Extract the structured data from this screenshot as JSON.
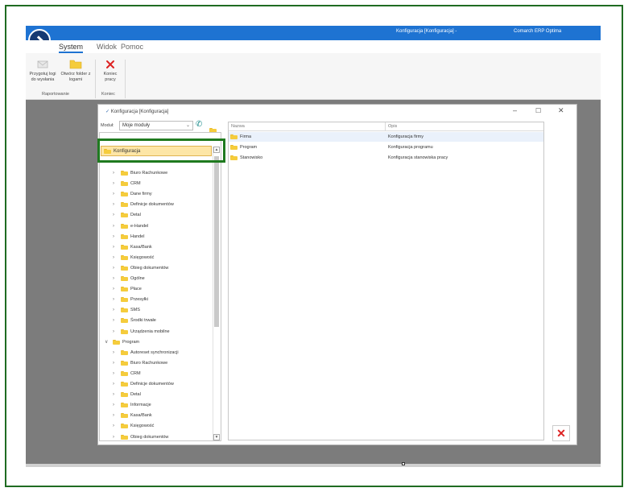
{
  "app": {
    "window_title": "Konfiguracja [Konfiguracja] -",
    "app_name": "Comarch ERP Optima"
  },
  "ribbon": {
    "tabs": [
      {
        "label": "System",
        "active": true
      },
      {
        "label": "Widok",
        "active": false
      },
      {
        "label": "Pomoc",
        "active": false
      }
    ],
    "buttons": {
      "logs_prepare": "Przygotuj logi do wysłania",
      "open_logs_folder": "Otwórz folder z logami",
      "end_work": "Koniec pracy"
    },
    "groups": {
      "reporting": "Raportowanie",
      "end": "Koniec"
    }
  },
  "config_window": {
    "title": "Konfiguracja [Konfiguracja]",
    "module_label": "Moduł:",
    "module_value": "Moje moduły",
    "tree_selected": "Konfiguracja",
    "tree": [
      {
        "label": "Biuro Rachunkowe"
      },
      {
        "label": "CRM"
      },
      {
        "label": "Dane firmy"
      },
      {
        "label": "Definicje dokumentów"
      },
      {
        "label": "Detal"
      },
      {
        "label": "e-Handel"
      },
      {
        "label": "Handel"
      },
      {
        "label": "Kasa/Bank"
      },
      {
        "label": "Księgowość"
      },
      {
        "label": "Obieg dokumentów"
      },
      {
        "label": "Ogólne"
      },
      {
        "label": "Płace"
      },
      {
        "label": "Przesyłki"
      },
      {
        "label": "SMS"
      },
      {
        "label": "Środki trwałe"
      },
      {
        "label": "Urządzenia mobilne"
      },
      {
        "label": "Program"
      },
      {
        "label": "Autoreset synchronizacji"
      },
      {
        "label": "Biuro Rachunkowe"
      },
      {
        "label": "CRM"
      },
      {
        "label": "Definicje dokumentów"
      },
      {
        "label": "Detal"
      },
      {
        "label": "Informacje"
      },
      {
        "label": "Kasa/Bank"
      },
      {
        "label": "Księgowość"
      },
      {
        "label": "Obieg dokumentów"
      }
    ],
    "grid": {
      "headers": {
        "name": "Nazwa",
        "description": "Opis"
      },
      "rows": [
        {
          "name": "Firma",
          "description": "Konfiguracja firmy"
        },
        {
          "name": "Program",
          "description": "Konfiguracja programu"
        },
        {
          "name": "Stanowisko",
          "description": "Konfiguracja stanowiska pracy"
        }
      ]
    }
  },
  "colors": {
    "title_bar": "#1e73d2",
    "highlight_border": "#1f7a1f",
    "selection_fill": "#fde6a6",
    "folder": "#f5cc3c",
    "close_red": "#dd2222"
  }
}
